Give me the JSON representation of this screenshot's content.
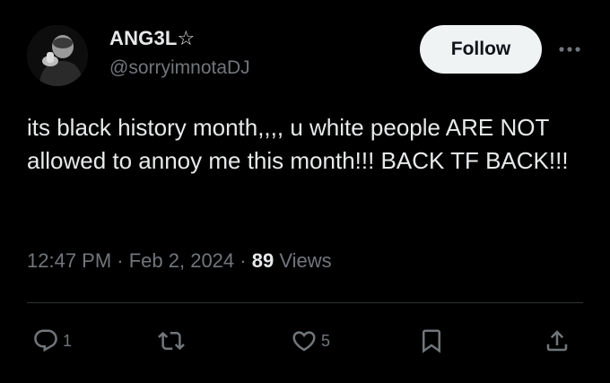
{
  "author": {
    "display_name": "ANG3L☆",
    "handle": "@sorryimnotaDJ"
  },
  "follow_label": "Follow",
  "text": "its black history month,,,, u white people ARE NOT allowed to annoy me this month!!! BACK TF BACK!!!",
  "meta": {
    "time": "12:47 PM",
    "sep1": " · ",
    "date": "Feb 2, 2024",
    "sep2": " · ",
    "views_count": "89",
    "views_label": " Views"
  },
  "actions": {
    "reply_count": "1",
    "repost_count": "",
    "like_count": "5"
  },
  "icons": {
    "more": "more-dots-icon",
    "reply": "reply-icon",
    "repost": "repost-icon",
    "like": "heart-icon",
    "bookmark": "bookmark-icon",
    "share": "share-icon"
  },
  "colors": {
    "background": "#000000",
    "text_primary": "#e7e9ea",
    "text_secondary": "#71767b",
    "follow_bg": "#eff3f4",
    "divider": "#2f3336"
  }
}
